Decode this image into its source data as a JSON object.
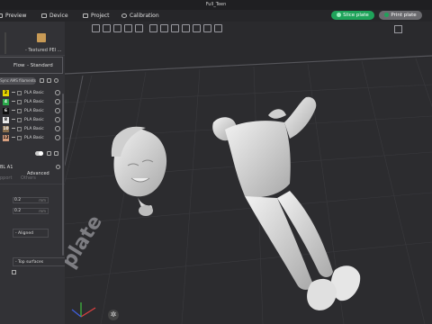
{
  "window": {
    "title": "Full_Teen"
  },
  "menubar": {
    "tabs": [
      {
        "label": "Preview",
        "icon": "preview-icon"
      },
      {
        "label": "Device",
        "icon": "device-icon"
      },
      {
        "label": "Project",
        "icon": "project-icon"
      },
      {
        "label": "Calibration",
        "icon": "calibration-icon"
      }
    ],
    "slice_label": "Slice plate",
    "print_label": "Print plate",
    "accent": "#1fa35a"
  },
  "sidebar": {
    "plate_type": "- Textured PEI ...",
    "flow_label": "Flow",
    "flow_value": "- Standard",
    "sync_label": "Sync AMS filaments",
    "filaments": [
      {
        "slot": "2",
        "color": "#e6d400",
        "text_color": "#000",
        "name": "PLA Basic"
      },
      {
        "slot": "4",
        "color": "#2aa84a",
        "text_color": "#fff",
        "name": "PLA Basic"
      },
      {
        "slot": "6",
        "color": "#111111",
        "text_color": "#fff",
        "name": "PLA Basic"
      },
      {
        "slot": "8",
        "color": "#e8e8e8",
        "text_color": "#000",
        "name": "PLA Basic"
      },
      {
        "slot": "10",
        "color": "#8a6f4d",
        "text_color": "#fff",
        "name": "PLA Basic"
      },
      {
        "slot": "12",
        "color": "#d8a080",
        "text_color": "#000",
        "name": "PLA Basic"
      }
    ],
    "advanced_label": "Advanced",
    "printer_label": "BL A1",
    "tab_support": "pport",
    "tab_others": "Others",
    "layer_height": "0.2",
    "initial_layer_height": "0.2",
    "unit": "mm",
    "seam_value": "- Aligned",
    "top_surface_value": "- Top surfaces"
  },
  "viewport": {
    "plate_text": "plate"
  }
}
